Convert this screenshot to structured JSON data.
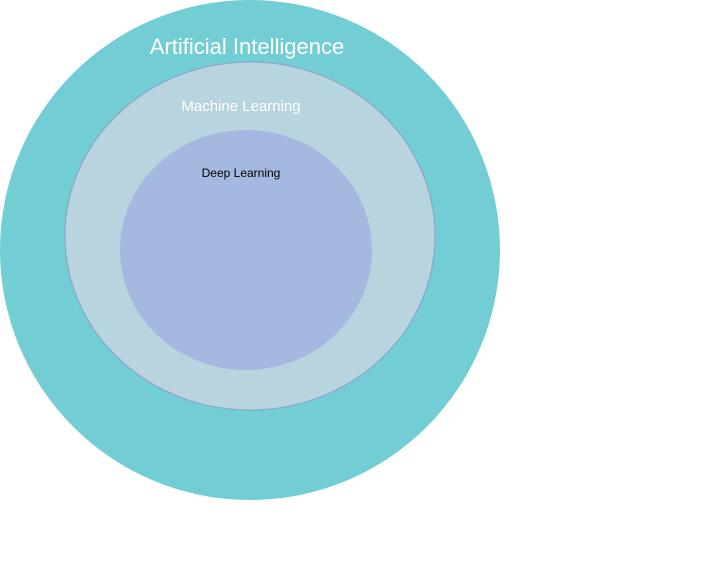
{
  "diagram": {
    "outer": {
      "label": "Artificial Intelligence",
      "fill": "#72cdd4",
      "text_color": "#ffffff"
    },
    "middle": {
      "label": "Machine Learning",
      "fill": "#b7d4df",
      "stroke": "#8f9fc7",
      "text_color": "#ffffff"
    },
    "inner": {
      "label": "Deep Learning",
      "fill": "#a5b9e0",
      "text_color": "#000000"
    }
  }
}
